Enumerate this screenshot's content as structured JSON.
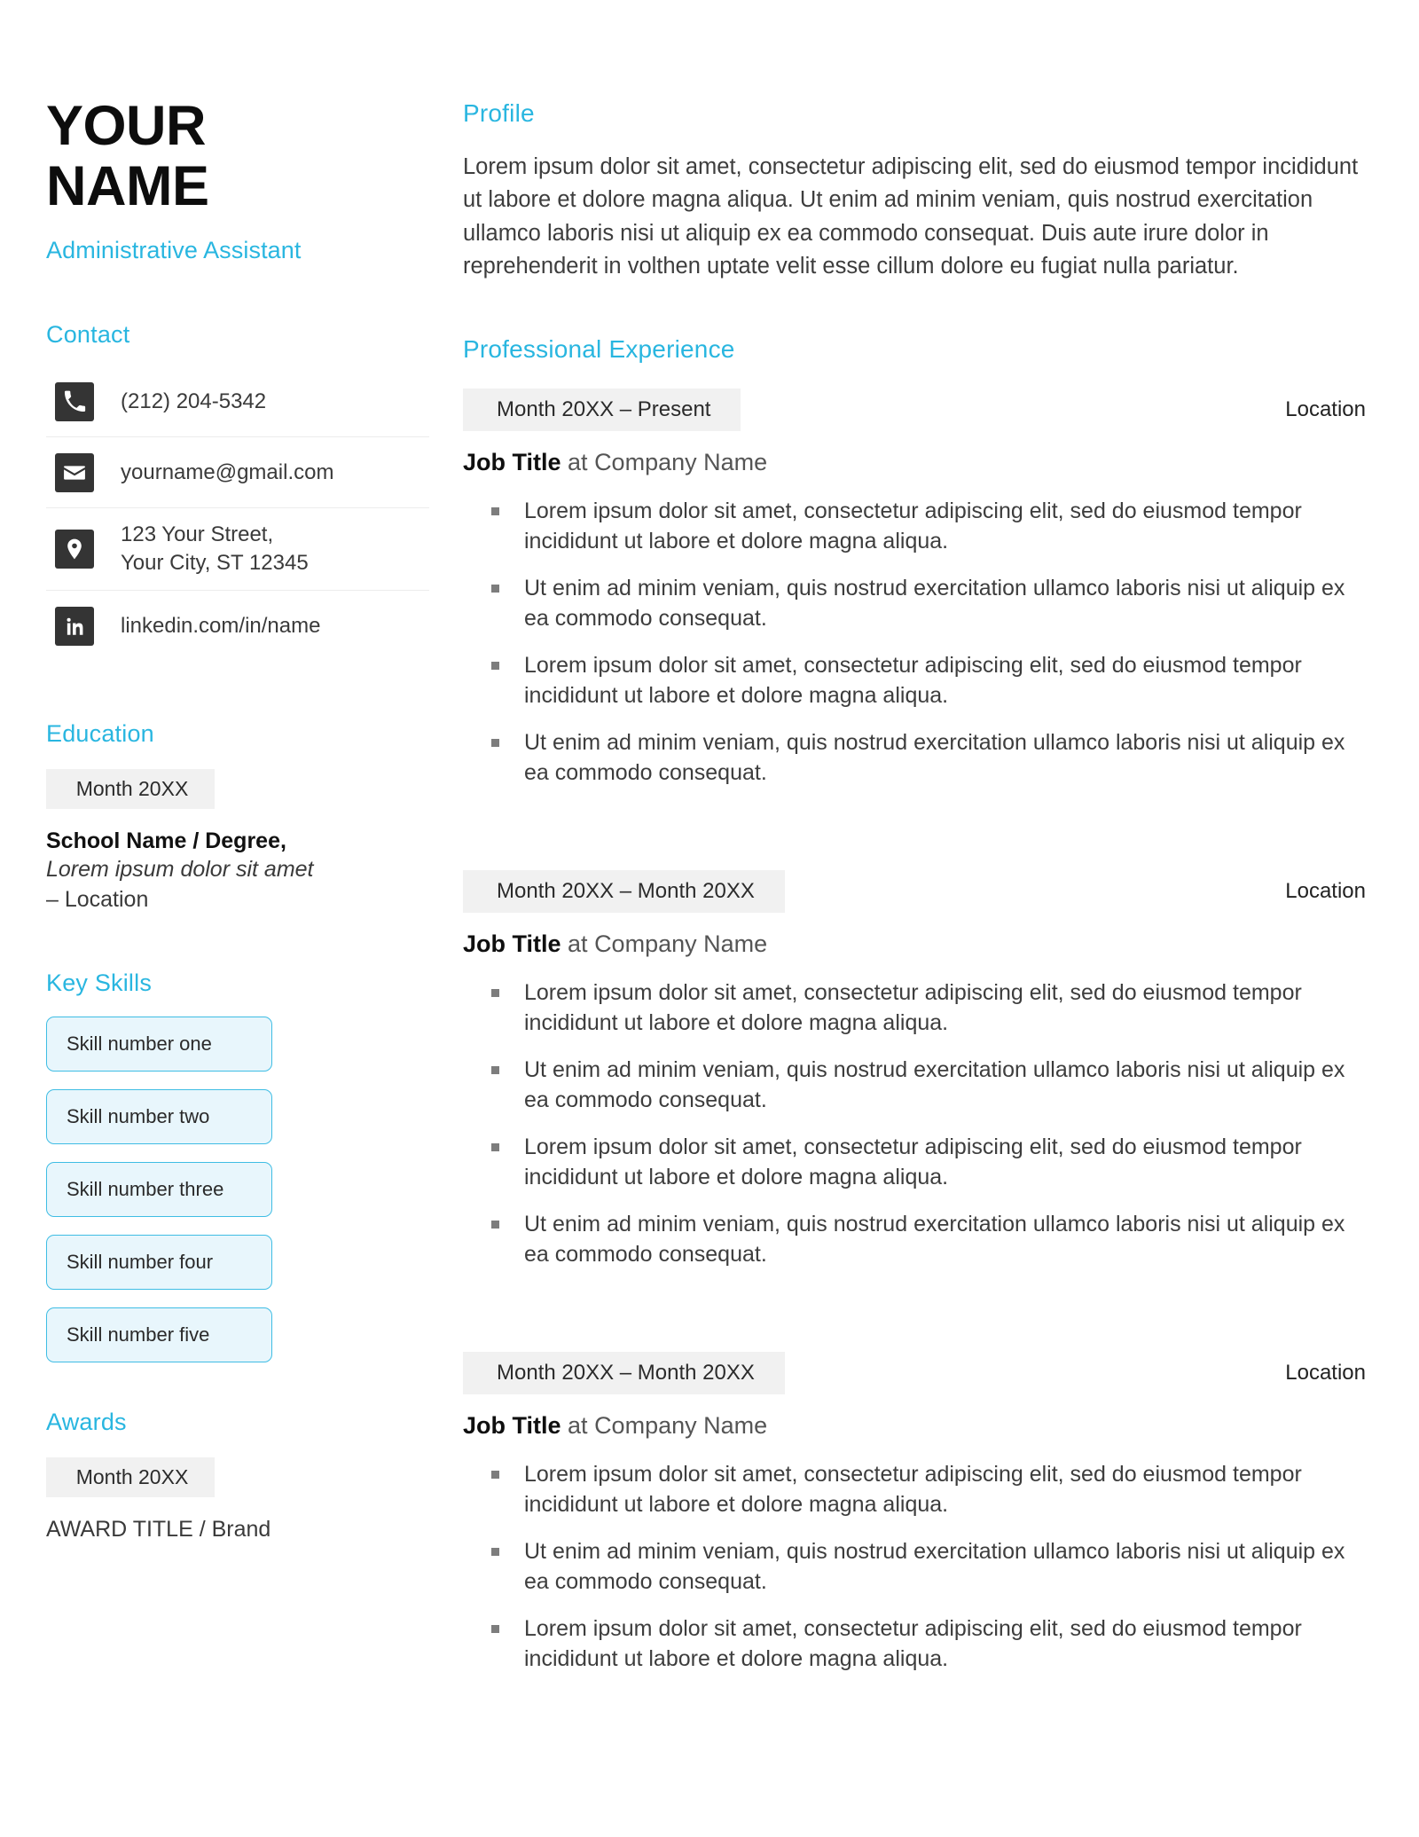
{
  "header": {
    "name_line_1": "YOUR",
    "name_line_2": "NAME",
    "job_subtitle": "Administrative Assistant"
  },
  "theme": {
    "accent": "#29b6e0",
    "icon_bg": "#343434",
    "badge_bg": "#f1f1f1",
    "pill_bg": "#e8f6fc",
    "pill_border": "#3fbde4"
  },
  "sidebar": {
    "contact": {
      "heading": "Contact",
      "items": [
        {
          "icon": "phone-icon",
          "value": "(212) 204-5342"
        },
        {
          "icon": "email-icon",
          "value": "yourname@gmail.com"
        },
        {
          "icon": "location-pin-icon",
          "value_line_1": "123 Your Street,",
          "value_line_2": "Your City, ST 12345"
        },
        {
          "icon": "linkedin-icon",
          "value": "linkedin.com/in/name"
        }
      ]
    },
    "education": {
      "heading": "Education",
      "date_badge": "Month 20XX",
      "school": "School Name / Degree,",
      "detail": "Lorem ipsum dolor sit amet",
      "location": "– Location"
    },
    "skills": {
      "heading": "Key Skills",
      "items": [
        "Skill number one",
        "Skill number two",
        "Skill number three",
        "Skill number four",
        "Skill number five"
      ]
    },
    "awards": {
      "heading": "Awards",
      "date_badge": "Month 20XX",
      "title": "AWARD TITLE / Brand"
    }
  },
  "main": {
    "profile": {
      "heading": "Profile",
      "body": "Lorem ipsum dolor sit amet, consectetur adipiscing elit, sed do eiusmod tempor incididunt ut labore et dolore magna aliqua. Ut enim ad minim veniam, quis nostrud exercitation ullamco laboris nisi ut aliquip ex ea commodo consequat. Duis aute irure dolor in reprehenderit in volthen uptate velit esse cillum dolore eu fugiat nulla pariatur."
    },
    "experience": {
      "heading": "Professional Experience",
      "jobs": [
        {
          "dates": "Month 20XX – Present",
          "location": "Location",
          "title": "Job Title",
          "at": " at ",
          "company": "Company Name",
          "bullets": [
            "Lorem ipsum dolor sit amet, consectetur adipiscing elit, sed do eiusmod tempor incididunt ut labore et dolore magna aliqua.",
            "Ut enim ad minim veniam, quis nostrud exercitation ullamco laboris nisi ut aliquip ex ea commodo consequat.",
            "Lorem ipsum dolor sit amet, consectetur adipiscing elit, sed do eiusmod tempor incididunt ut labore et dolore magna aliqua.",
            "Ut enim ad minim veniam, quis nostrud exercitation ullamco laboris nisi ut aliquip ex ea commodo consequat."
          ]
        },
        {
          "dates": "Month 20XX – Month 20XX",
          "location": "Location",
          "title": "Job Title",
          "at": " at ",
          "company": "Company Name",
          "bullets": [
            "Lorem ipsum dolor sit amet, consectetur adipiscing elit, sed do eiusmod tempor incididunt ut labore et dolore magna aliqua.",
            "Ut enim ad minim veniam, quis nostrud exercitation ullamco laboris nisi ut aliquip ex ea commodo consequat.",
            "Lorem ipsum dolor sit amet, consectetur adipiscing elit, sed do eiusmod tempor incididunt ut labore et dolore magna aliqua.",
            "Ut enim ad minim veniam, quis nostrud exercitation ullamco laboris nisi ut aliquip ex ea commodo consequat."
          ]
        },
        {
          "dates": "Month 20XX – Month 20XX",
          "location": "Location",
          "title": "Job Title",
          "at": " at ",
          "company": "Company Name",
          "bullets": [
            "Lorem ipsum dolor sit amet, consectetur adipiscing elit, sed do eiusmod tempor incididunt ut labore et dolore magna aliqua.",
            "Ut enim ad minim veniam, quis nostrud exercitation ullamco laboris nisi ut aliquip ex ea commodo consequat.",
            "Lorem ipsum dolor sit amet, consectetur adipiscing elit, sed do eiusmod tempor incididunt ut labore et dolore magna aliqua."
          ]
        }
      ]
    }
  }
}
